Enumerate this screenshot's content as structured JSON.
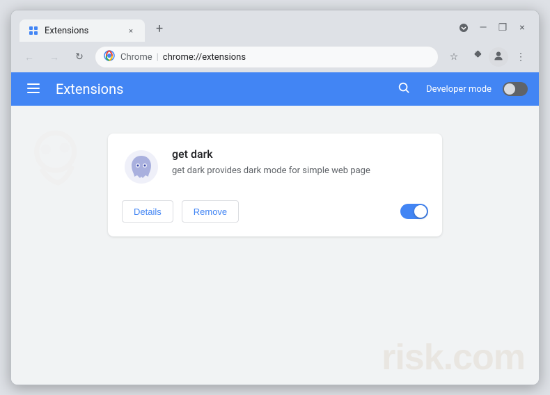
{
  "window": {
    "title": "Extensions",
    "tab_title": "Extensions",
    "close_label": "×",
    "minimize_label": "—",
    "maximize_label": "❐",
    "new_tab_label": "+"
  },
  "toolbar": {
    "back_label": "←",
    "forward_label": "→",
    "reload_label": "↻",
    "brand": "Chrome",
    "separator": "|",
    "url": "chrome://extensions",
    "bookmark_icon": "☆",
    "extensions_icon": "🧩",
    "profile_icon": "👤",
    "menu_icon": "⋮"
  },
  "extensions_page": {
    "header_title": "Extensions",
    "menu_icon": "≡",
    "search_icon": "🔍",
    "dev_mode_label": "Developer mode",
    "toggle_state": "off"
  },
  "extension_card": {
    "name": "get dark",
    "description": "get dark provides dark mode for simple web page",
    "details_btn": "Details",
    "remove_btn": "Remove",
    "enabled": true
  },
  "watermark": {
    "line1": "risk.com"
  }
}
